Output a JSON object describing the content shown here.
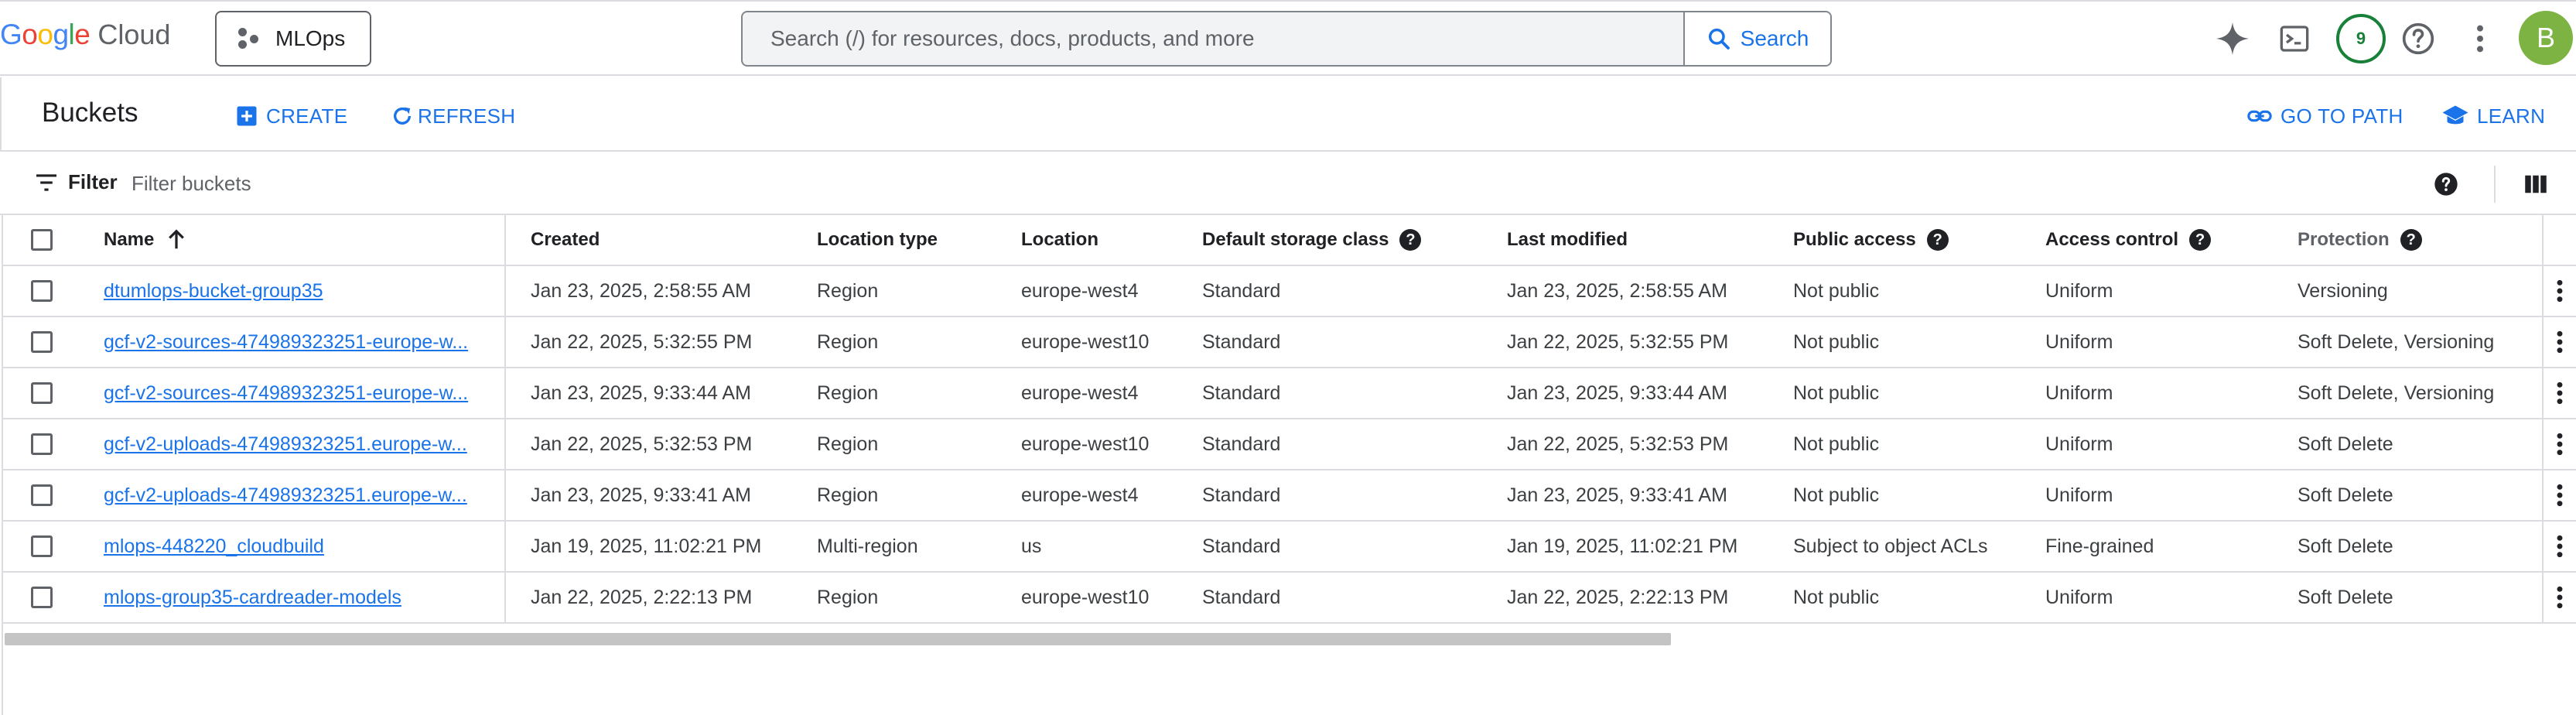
{
  "header": {
    "logo_google": "Google",
    "logo_cloud": "Cloud",
    "project": "MLOps",
    "search_placeholder": "Search (/) for resources, docs, products, and more",
    "search_button": "Search",
    "notifications_count": "9",
    "avatar_initial": "B"
  },
  "toolbar": {
    "title": "Buckets",
    "create": "CREATE",
    "refresh": "REFRESH",
    "go_to_path": "GO TO PATH",
    "learn": "LEARN"
  },
  "filter": {
    "label": "Filter",
    "placeholder": "Filter buckets"
  },
  "table": {
    "headers": {
      "name": "Name",
      "created": "Created",
      "location_type": "Location type",
      "location": "Location",
      "storage_class": "Default storage class",
      "last_modified": "Last modified",
      "public_access": "Public access",
      "access_control": "Access control",
      "protection": "Protection"
    },
    "rows": [
      {
        "name": "dtumlops-bucket-group35",
        "created": "Jan 23, 2025, 2:58:55 AM",
        "location_type": "Region",
        "location": "europe-west4",
        "storage_class": "Standard",
        "last_modified": "Jan 23, 2025, 2:58:55 AM",
        "public_access": "Not public",
        "access_control": "Uniform",
        "protection": "Versioning"
      },
      {
        "name": "gcf-v2-sources-474989323251-europe-w...",
        "created": "Jan 22, 2025, 5:32:55 PM",
        "location_type": "Region",
        "location": "europe-west10",
        "storage_class": "Standard",
        "last_modified": "Jan 22, 2025, 5:32:55 PM",
        "public_access": "Not public",
        "access_control": "Uniform",
        "protection": "Soft Delete, Versioning"
      },
      {
        "name": "gcf-v2-sources-474989323251-europe-w...",
        "created": "Jan 23, 2025, 9:33:44 AM",
        "location_type": "Region",
        "location": "europe-west4",
        "storage_class": "Standard",
        "last_modified": "Jan 23, 2025, 9:33:44 AM",
        "public_access": "Not public",
        "access_control": "Uniform",
        "protection": "Soft Delete, Versioning"
      },
      {
        "name": "gcf-v2-uploads-474989323251.europe-w...",
        "created": "Jan 22, 2025, 5:32:53 PM",
        "location_type": "Region",
        "location": "europe-west10",
        "storage_class": "Standard",
        "last_modified": "Jan 22, 2025, 5:32:53 PM",
        "public_access": "Not public",
        "access_control": "Uniform",
        "protection": "Soft Delete"
      },
      {
        "name": "gcf-v2-uploads-474989323251.europe-w...",
        "created": "Jan 23, 2025, 9:33:41 AM",
        "location_type": "Region",
        "location": "europe-west4",
        "storage_class": "Standard",
        "last_modified": "Jan 23, 2025, 9:33:41 AM",
        "public_access": "Not public",
        "access_control": "Uniform",
        "protection": "Soft Delete"
      },
      {
        "name": "mlops-448220_cloudbuild",
        "created": "Jan 19, 2025, 11:02:21 PM",
        "location_type": "Multi-region",
        "location": "us",
        "storage_class": "Standard",
        "last_modified": "Jan 19, 2025, 11:02:21 PM",
        "public_access": "Subject to object ACLs",
        "access_control": "Fine-grained",
        "protection": "Soft Delete"
      },
      {
        "name": "mlops-group35-cardreader-models",
        "created": "Jan 22, 2025, 2:22:13 PM",
        "location_type": "Region",
        "location": "europe-west10",
        "storage_class": "Standard",
        "last_modified": "Jan 22, 2025, 2:22:13 PM",
        "public_access": "Not public",
        "access_control": "Uniform",
        "protection": "Soft Delete"
      }
    ]
  },
  "colors": {
    "accent": "#1a73e8",
    "border": "#dadce0",
    "notif_green": "#188038",
    "avatar_green": "#7cb342"
  },
  "icons": [
    "sparkle-icon",
    "terminal-icon",
    "help-icon",
    "more-vert-icon",
    "search-icon",
    "add-box-icon",
    "refresh-icon",
    "link-icon",
    "learn-icon",
    "filter-icon",
    "column-icon",
    "sort-arrow-up-icon"
  ]
}
